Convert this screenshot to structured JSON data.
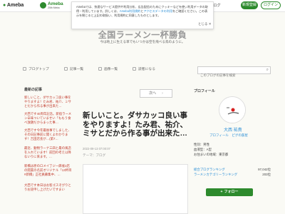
{
  "header": {
    "logo_text": "Ameba",
    "logo2_text": "Ameba",
    "logo2_sub": "20th Meba",
    "popular": "人気ブログ",
    "register": "新規登録",
    "login": "ログイン"
  },
  "cookie": {
    "text_a": "Amebaでは、快適なサービス提供や利用分析、広告配信のためにクッキーなどを使い利用データの取得・利用しています。詳しくは、",
    "link1": "Ameba利用規約",
    "text_b": "と",
    "link2": "アクセスデータの利用",
    "text_c": "をご確認ください。この表示を閉じると上記の取扱い、利用規約に同意したものとします。",
    "close": "とじる"
  },
  "blog": {
    "title": "全国ラーメン一杯勝負",
    "description": "今は地上に生える草でもいつかは空を飛べる鳥のように。"
  },
  "nav": {
    "items": [
      "ブログトップ",
      "記事一覧",
      "画像一覧",
      "読者になる"
    ],
    "search_placeholder": "このブログの記事を検索"
  },
  "left": {
    "heading": "最新の記事",
    "posts": [
      {
        "title": "新しいこと、ダサカッコ良い事をやりますよ！たみ君、祐介、ミサとだから作る事が出来た…",
        "date": ""
      },
      {
        "title": "大西です40周年記念。新宿ラーメン辛味ついていませい「ももう食べ放題だからまった事…",
        "date": ""
      },
      {
        "title": "大西です今年最後事でしました、その日記事前に開くよわかります！吉田店長が…(第7…",
        "date": ""
      },
      {
        "title": "最近、動物ラーナ三四と最の風恋を入れています！前回の考え以降ないりに来ます。…",
        "date": ""
      },
      {
        "title": "新橋は原のロメイ了ジー麻雀2店の開業の名前オリジナル「13杯目#新橋」正社員募集中、…",
        "date": ""
      },
      {
        "title": "大西です本日はお客ゴスぞがりとりお詫申し上げたいですまい",
        "date": ""
      }
    ]
  },
  "entry": {
    "next_label": "次へ",
    "title": "新しいこと。ダサカッコ良い事をやりますよ！たみ君、祐介、ミサとだから作る事が出来た…",
    "meta": "2022-09-13 07:00:07",
    "theme": "テーマ：ブログ"
  },
  "profile": {
    "heading": "プロフィール",
    "name": "大西 祐貴",
    "links": "プロフィール　ピグの部屋",
    "gender": "性別：男性",
    "blood": "血液型：A型",
    "home": "お住まいの地域：東京都",
    "rank_label1": "総合ブログランキング",
    "rank_value1": "97,042位",
    "rank_label2": "ラーメンカテゴリーランキング",
    "rank_value2": "203位",
    "follow": "フォロー"
  },
  "colors": {
    "brand_green": "#2d8a2d",
    "link_blue": "#2c8fd6",
    "post_red": "#c0392b"
  }
}
